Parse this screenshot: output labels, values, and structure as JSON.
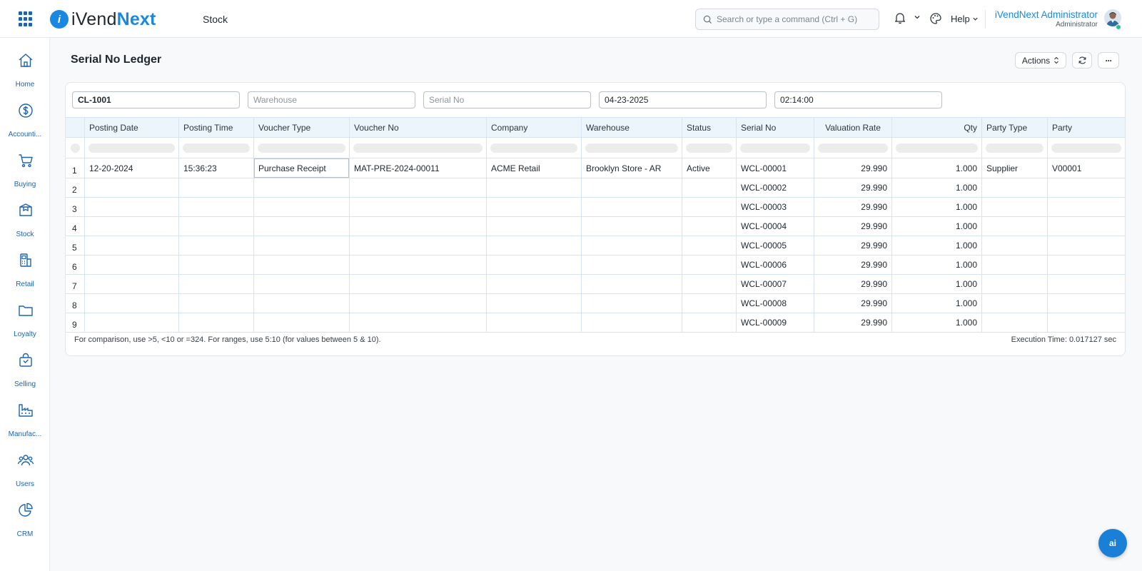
{
  "app": {
    "logo_left": "iVend",
    "logo_right": "Next",
    "breadcrumb": "Stock",
    "search_placeholder": "Search or type a command (Ctrl + G)",
    "help_label": "Help",
    "user_name": "iVendNext Administrator",
    "user_role": "Administrator"
  },
  "sidebar": {
    "items": [
      {
        "label": "Home",
        "icon": "home-icon"
      },
      {
        "label": "Accounti...",
        "icon": "dollar-icon"
      },
      {
        "label": "Buying",
        "icon": "cart-icon"
      },
      {
        "label": "Stock",
        "icon": "box-icon"
      },
      {
        "label": "Retail",
        "icon": "pos-icon"
      },
      {
        "label": "Loyalty",
        "icon": "folder-icon"
      },
      {
        "label": "Selling",
        "icon": "shopping-bag-icon"
      },
      {
        "label": "Manufac...",
        "icon": "factory-icon"
      },
      {
        "label": "Users",
        "icon": "users-icon"
      },
      {
        "label": "CRM",
        "icon": "pie-chart-icon"
      }
    ]
  },
  "page": {
    "title": "Serial No Ledger",
    "actions_label": "Actions",
    "more_label": "···"
  },
  "filters": {
    "item": "CL-1001",
    "warehouse_placeholder": "Warehouse",
    "serial_no_placeholder": "Serial No",
    "date": "04-23-2025",
    "time": "02:14:00"
  },
  "table": {
    "columns": [
      "Posting Date",
      "Posting Time",
      "Voucher Type",
      "Voucher No",
      "Company",
      "Warehouse",
      "Status",
      "Serial No",
      "Valuation Rate",
      "Qty",
      "Party Type",
      "Party"
    ],
    "rows": [
      {
        "n": "1",
        "posting_date": "12-20-2024",
        "posting_time": "15:36:23",
        "voucher_type": "Purchase Receipt",
        "voucher_no": "MAT-PRE-2024-00011",
        "company": "ACME Retail",
        "warehouse": "Brooklyn Store - AR",
        "status": "Active",
        "serial_no": "WCL-00001",
        "valuation_rate": "29.990",
        "qty": "1.000",
        "party_type": "Supplier",
        "party": "V00001"
      },
      {
        "n": "2",
        "posting_date": "",
        "posting_time": "",
        "voucher_type": "",
        "voucher_no": "",
        "company": "",
        "warehouse": "",
        "status": "",
        "serial_no": "WCL-00002",
        "valuation_rate": "29.990",
        "qty": "1.000",
        "party_type": "",
        "party": ""
      },
      {
        "n": "3",
        "posting_date": "",
        "posting_time": "",
        "voucher_type": "",
        "voucher_no": "",
        "company": "",
        "warehouse": "",
        "status": "",
        "serial_no": "WCL-00003",
        "valuation_rate": "29.990",
        "qty": "1.000",
        "party_type": "",
        "party": ""
      },
      {
        "n": "4",
        "posting_date": "",
        "posting_time": "",
        "voucher_type": "",
        "voucher_no": "",
        "company": "",
        "warehouse": "",
        "status": "",
        "serial_no": "WCL-00004",
        "valuation_rate": "29.990",
        "qty": "1.000",
        "party_type": "",
        "party": ""
      },
      {
        "n": "5",
        "posting_date": "",
        "posting_time": "",
        "voucher_type": "",
        "voucher_no": "",
        "company": "",
        "warehouse": "",
        "status": "",
        "serial_no": "WCL-00005",
        "valuation_rate": "29.990",
        "qty": "1.000",
        "party_type": "",
        "party": ""
      },
      {
        "n": "6",
        "posting_date": "",
        "posting_time": "",
        "voucher_type": "",
        "voucher_no": "",
        "company": "",
        "warehouse": "",
        "status": "",
        "serial_no": "WCL-00006",
        "valuation_rate": "29.990",
        "qty": "1.000",
        "party_type": "",
        "party": ""
      },
      {
        "n": "7",
        "posting_date": "",
        "posting_time": "",
        "voucher_type": "",
        "voucher_no": "",
        "company": "",
        "warehouse": "",
        "status": "",
        "serial_no": "WCL-00007",
        "valuation_rate": "29.990",
        "qty": "1.000",
        "party_type": "",
        "party": ""
      },
      {
        "n": "8",
        "posting_date": "",
        "posting_time": "",
        "voucher_type": "",
        "voucher_no": "",
        "company": "",
        "warehouse": "",
        "status": "",
        "serial_no": "WCL-00008",
        "valuation_rate": "29.990",
        "qty": "1.000",
        "party_type": "",
        "party": ""
      },
      {
        "n": "9",
        "posting_date": "",
        "posting_time": "",
        "voucher_type": "",
        "voucher_no": "",
        "company": "",
        "warehouse": "",
        "status": "",
        "serial_no": "WCL-00009",
        "valuation_rate": "29.990",
        "qty": "1.000",
        "party_type": "",
        "party": ""
      }
    ]
  },
  "footer": {
    "hint": "For comparison, use >5, <10 or =324. For ranges, use 5:10 (for values between 5 & 10).",
    "execution_time": "Execution Time: 0.017127 sec"
  },
  "assistant": {
    "label": "ai"
  },
  "colors": {
    "brand": "#1a88e0",
    "link": "#1d63b0",
    "header_bg": "#edf5fc",
    "grid_line": "#d6e4f2"
  }
}
